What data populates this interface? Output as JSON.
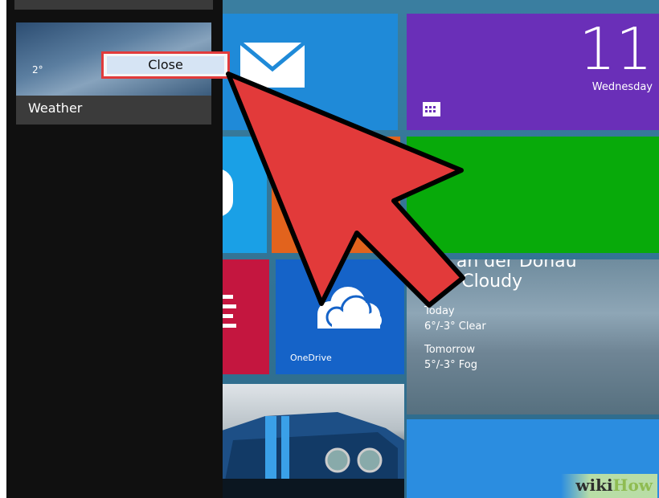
{
  "switcher": {
    "app_title": "Weather",
    "thumb_temp": "2°",
    "context_menu": {
      "close_label": "Close"
    }
  },
  "start_screen": {
    "calendar": {
      "day": "11",
      "weekday": "Wednesday"
    },
    "weather": {
      "city": "ms an der Donau",
      "condition": "stly Cloudy",
      "today_label": "Today",
      "today_forecast": "6°/-3° Clear",
      "tomorrow_label": "Tomorrow",
      "tomorrow_forecast": "5°/-3° Fog"
    },
    "onedrive": {
      "label": "OneDrive"
    }
  },
  "watermark": {
    "prefix": "wiki",
    "suffix": "How"
  },
  "colors": {
    "mail": "#1f8ad8",
    "calendar": "#6a2fb8",
    "green_tile": "#08aa0a",
    "onedrive": "#1563c8",
    "red_tile": "#c4163f",
    "arrow": "#e23a3a",
    "highlight": "#e13b3b"
  }
}
